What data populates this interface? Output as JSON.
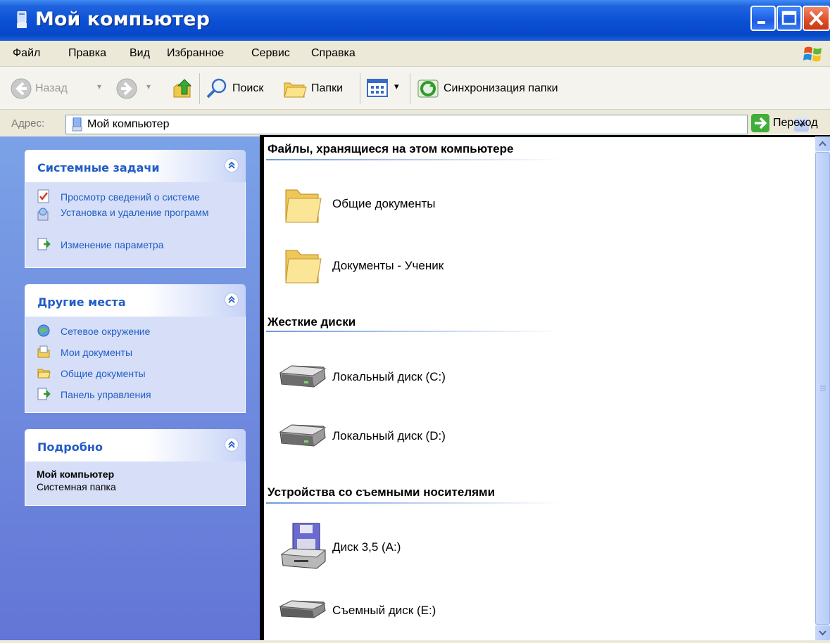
{
  "window": {
    "title": "Мой компьютер"
  },
  "menu": {
    "items": [
      "Файл",
      "Правка",
      "Вид",
      "Избранное",
      "Сервис",
      "Справка"
    ]
  },
  "toolbar": {
    "back_label": "Назад",
    "search_label": "Поиск",
    "folders_label": "Папки",
    "sync_label": "Синхронизация папки"
  },
  "address": {
    "label": "Адрес:",
    "value": "Мой компьютер",
    "go_label": "Переход"
  },
  "left_pane": {
    "system_tasks": {
      "title": "Системные задачи",
      "links": [
        "Просмотр сведений о системе",
        "Установка и удаление программ",
        "Изменение параметра"
      ]
    },
    "other_places": {
      "title": "Другие места",
      "links": [
        "Сетевое окружение",
        "Мои документы",
        "Общие документы",
        "Панель управления"
      ]
    },
    "details": {
      "title": "Подробно",
      "name": "Мой компьютер",
      "type": "Системная папка"
    }
  },
  "content": {
    "groups": [
      {
        "title": "Файлы, хранящиеся на этом компьютере",
        "items": [
          "Общие документы",
          "Документы - Ученик"
        ]
      },
      {
        "title": "Жесткие диски",
        "items": [
          "Локальный диск (C:)",
          "Локальный диск (D:)"
        ]
      },
      {
        "title": "Устройства со съемными носителями",
        "items": [
          "Диск 3,5 (A:)",
          "Съемный диск (E:)"
        ]
      }
    ]
  }
}
